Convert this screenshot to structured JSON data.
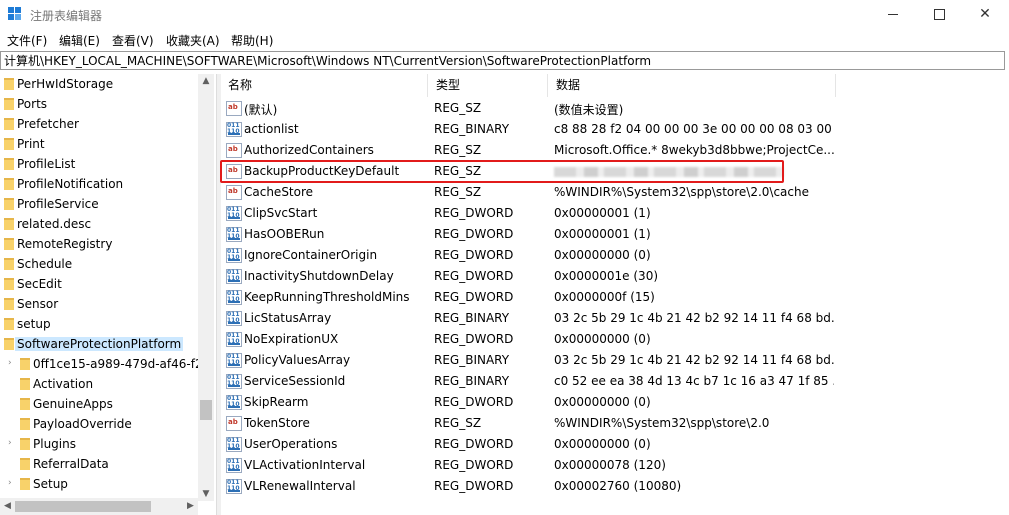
{
  "window": {
    "title": "注册表编辑器",
    "minimize_label": "",
    "maximize_label": "",
    "close_label": "✕"
  },
  "menu": [
    "文件(F)",
    "编辑(E)",
    "查看(V)",
    "收藏夹(A)",
    "帮助(H)"
  ],
  "address": "计算机\\HKEY_LOCAL_MACHINE\\SOFTWARE\\Microsoft\\Windows NT\\CurrentVersion\\SoftwareProtectionPlatform",
  "tree": {
    "items": [
      {
        "label": "PerHwIdStorage",
        "level": 0
      },
      {
        "label": "Ports",
        "level": 0
      },
      {
        "label": "Prefetcher",
        "level": 0
      },
      {
        "label": "Print",
        "level": 0
      },
      {
        "label": "ProfileList",
        "level": 0
      },
      {
        "label": "ProfileNotification",
        "level": 0
      },
      {
        "label": "ProfileService",
        "level": 0
      },
      {
        "label": "related.desc",
        "level": 0
      },
      {
        "label": "RemoteRegistry",
        "level": 0
      },
      {
        "label": "Schedule",
        "level": 0
      },
      {
        "label": "SecEdit",
        "level": 0
      },
      {
        "label": "Sensor",
        "level": 0
      },
      {
        "label": "setup",
        "level": 0
      },
      {
        "label": "SoftwareProtectionPlatform",
        "level": 0,
        "selected": true
      },
      {
        "label": "0ff1ce15-a989-479d-af46-f2",
        "level": 1,
        "expandable": true
      },
      {
        "label": "Activation",
        "level": 1
      },
      {
        "label": "GenuineApps",
        "level": 1
      },
      {
        "label": "PayloadOverride",
        "level": 1
      },
      {
        "label": "Plugins",
        "level": 1,
        "expandable": true
      },
      {
        "label": "ReferralData",
        "level": 1
      },
      {
        "label": "Setup",
        "level": 1,
        "expandable": true
      }
    ]
  },
  "list": {
    "columns": [
      "名称",
      "类型",
      "数据"
    ],
    "rows": [
      {
        "name": "(默认)",
        "type": "REG_SZ",
        "data": "(数值未设置)",
        "icon": "string-value-icon"
      },
      {
        "name": "actionlist",
        "type": "REG_BINARY",
        "data": "c8 88 28 f2 04 00 00 00 3e 00 00 00 08 03 00 ...",
        "icon": "binary-value-icon"
      },
      {
        "name": "AuthorizedContainers",
        "type": "REG_SZ",
        "data": "Microsoft.Office.* 8wekyb3d8bbwe;ProjectCe...",
        "icon": "string-value-icon"
      },
      {
        "name": "BackupProductKeyDefault",
        "type": "REG_SZ",
        "data": "",
        "icon": "string-value-icon",
        "highlighted": true,
        "redacted": true
      },
      {
        "name": "CacheStore",
        "type": "REG_SZ",
        "data": "%WINDIR%\\System32\\spp\\store\\2.0\\cache",
        "icon": "string-value-icon"
      },
      {
        "name": "ClipSvcStart",
        "type": "REG_DWORD",
        "data": "0x00000001 (1)",
        "icon": "binary-value-icon"
      },
      {
        "name": "HasOOBERun",
        "type": "REG_DWORD",
        "data": "0x00000001 (1)",
        "icon": "binary-value-icon"
      },
      {
        "name": "IgnoreContainerOrigin",
        "type": "REG_DWORD",
        "data": "0x00000000 (0)",
        "icon": "binary-value-icon"
      },
      {
        "name": "InactivityShutdownDelay",
        "type": "REG_DWORD",
        "data": "0x0000001e (30)",
        "icon": "binary-value-icon"
      },
      {
        "name": "KeepRunningThresholdMins",
        "type": "REG_DWORD",
        "data": "0x0000000f (15)",
        "icon": "binary-value-icon"
      },
      {
        "name": "LicStatusArray",
        "type": "REG_BINARY",
        "data": "03 2c 5b 29 1c 4b 21 42 b2 92 14 11 f4 68 bd...",
        "icon": "binary-value-icon"
      },
      {
        "name": "NoExpirationUX",
        "type": "REG_DWORD",
        "data": "0x00000000 (0)",
        "icon": "binary-value-icon"
      },
      {
        "name": "PolicyValuesArray",
        "type": "REG_BINARY",
        "data": "03 2c 5b 29 1c 4b 21 42 b2 92 14 11 f4 68 bd...",
        "icon": "binary-value-icon"
      },
      {
        "name": "ServiceSessionId",
        "type": "REG_BINARY",
        "data": "c0 52 ee ea 38 4d 13 4c b7 1c 16 a3 47 1f 85 ...",
        "icon": "binary-value-icon"
      },
      {
        "name": "SkipRearm",
        "type": "REG_DWORD",
        "data": "0x00000000 (0)",
        "icon": "binary-value-icon"
      },
      {
        "name": "TokenStore",
        "type": "REG_SZ",
        "data": "%WINDIR%\\System32\\spp\\store\\2.0",
        "icon": "string-value-icon"
      },
      {
        "name": "UserOperations",
        "type": "REG_DWORD",
        "data": "0x00000000 (0)",
        "icon": "binary-value-icon"
      },
      {
        "name": "VLActivationInterval",
        "type": "REG_DWORD",
        "data": "0x00000078 (120)",
        "icon": "binary-value-icon"
      },
      {
        "name": "VLRenewalInterval",
        "type": "REG_DWORD",
        "data": "0x00002760 (10080)",
        "icon": "binary-value-icon"
      }
    ]
  },
  "colors": {
    "highlight_border": "#e21b1b",
    "selection": "#cce8ff",
    "folder": "#f8d26a"
  }
}
